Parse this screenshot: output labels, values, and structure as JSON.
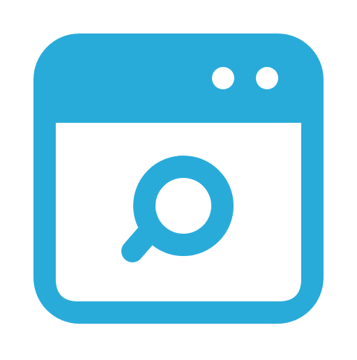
{
  "icon": {
    "name": "browser-search-icon",
    "window_dots": [
      "dot-1",
      "dot-2"
    ],
    "symbol": "magnifying-glass-icon"
  },
  "colors": {
    "primary": "#29ABDA",
    "background": "#FFFFFF"
  }
}
